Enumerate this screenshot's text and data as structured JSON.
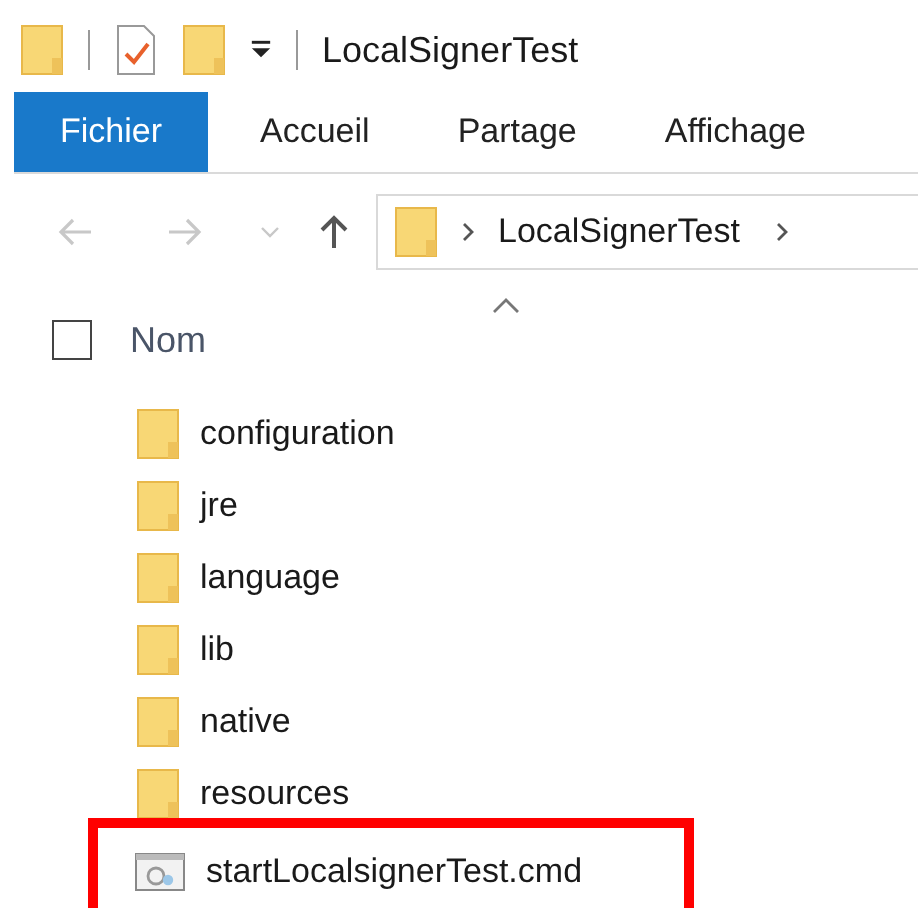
{
  "window": {
    "title": "LocalSignerTest"
  },
  "ribbon_tabs": [
    {
      "label": "Fichier",
      "selected": true
    },
    {
      "label": "Accueil",
      "selected": false
    },
    {
      "label": "Partage",
      "selected": false
    },
    {
      "label": "Affichage",
      "selected": false
    }
  ],
  "address_bar": {
    "path": [
      "LocalSignerTest"
    ]
  },
  "column_header": {
    "label": "Nom",
    "checked": false
  },
  "files": [
    {
      "name": "configuration",
      "kind": "folder",
      "highlighted": false
    },
    {
      "name": "jre",
      "kind": "folder",
      "highlighted": false
    },
    {
      "name": "language",
      "kind": "folder",
      "highlighted": false
    },
    {
      "name": "lib",
      "kind": "folder",
      "highlighted": false
    },
    {
      "name": "native",
      "kind": "folder",
      "highlighted": false
    },
    {
      "name": "resources",
      "kind": "folder",
      "highlighted": false
    },
    {
      "name": "startLocalsignerTest.cmd",
      "kind": "script",
      "highlighted": true
    }
  ]
}
